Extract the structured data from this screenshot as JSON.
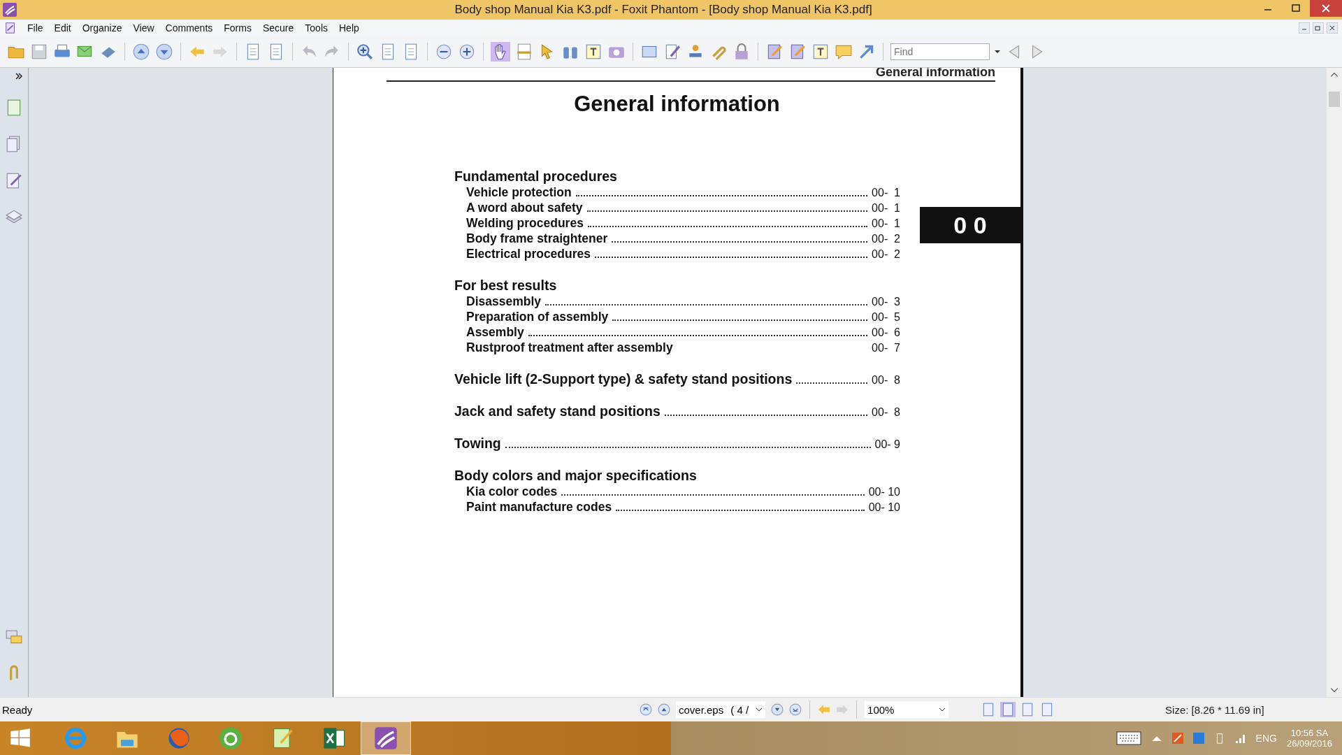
{
  "window": {
    "title": "Body shop Manual Kia K3.pdf - Foxit Phantom - [Body shop Manual Kia K3.pdf]"
  },
  "menu": [
    "File",
    "Edit",
    "Organize",
    "View",
    "Comments",
    "Forms",
    "Secure",
    "Tools",
    "Help"
  ],
  "toolbar": {
    "hand_selected": true,
    "find": {
      "placeholder": "Find"
    }
  },
  "document": {
    "running_header": "General information",
    "title": "General information",
    "tab_label": "0 0",
    "sections": [
      {
        "title": "Fundamental procedures",
        "entries": [
          {
            "label": "Vehicle protection",
            "page": "00-  1",
            "leader": true
          },
          {
            "label": "A word about safety",
            "page": "00-  1",
            "leader": true
          },
          {
            "label": "Welding procedures",
            "page": "00-  1",
            "leader": true
          },
          {
            "label": "Body frame straightener",
            "page": "00-  2",
            "leader": true
          },
          {
            "label": "Electrical procedures",
            "page": "00-  2",
            "leader": true
          }
        ]
      },
      {
        "title": "For best results",
        "entries": [
          {
            "label": "Disassembly",
            "page": "00-  3",
            "leader": true
          },
          {
            "label": "Preparation of assembly",
            "page": "00-  5",
            "leader": true
          },
          {
            "label": "Assembly",
            "page": "00-  6",
            "leader": true
          },
          {
            "label": "Rustproof treatment after assembly",
            "page": "00-  7",
            "leader": false
          }
        ]
      },
      {
        "title": "Vehicle lift (2-Support type) & safety stand positions",
        "page": "00-  8"
      },
      {
        "title": "Jack and safety stand positions",
        "page": "00-  8"
      },
      {
        "title": "Towing",
        "page": "00- 9"
      },
      {
        "title": "Body colors and major specifications",
        "entries": [
          {
            "label": "Kia color codes",
            "page": "00- 10",
            "leader": true
          },
          {
            "label": "Paint manufacture codes",
            "page": "00- 10",
            "leader": true
          }
        ]
      }
    ]
  },
  "status_bar": {
    "status": "Ready",
    "page_name": "cover.eps",
    "page_number": "( 4 /",
    "zoom": "100%",
    "size": "Size: [8.26 * 11.69 in]",
    "view_modes": [
      {
        "selected": false
      },
      {
        "selected": true
      },
      {
        "selected": false
      },
      {
        "selected": false
      }
    ]
  },
  "taskbar": {
    "apps": [
      {
        "selected": false
      },
      {
        "selected": false
      },
      {
        "selected": false
      },
      {
        "selected": false
      },
      {
        "selected": false
      },
      {
        "selected": false
      },
      {
        "selected": true
      }
    ],
    "tray": {
      "language": "ENG",
      "time": "10:56 SA",
      "date": "26/09/2016"
    }
  }
}
